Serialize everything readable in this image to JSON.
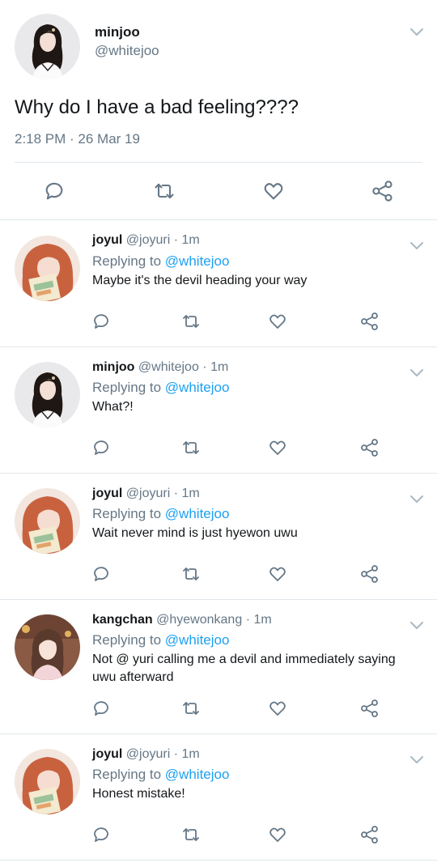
{
  "main_tweet": {
    "display_name": "minjoo",
    "handle": "@whitejoo",
    "text": "Why do I have a bad feeling????",
    "timestamp": "2:18 PM · 26 Mar 19",
    "avatar_icon": "avatar-minjoo",
    "actions": [
      "reply-icon",
      "retweet-icon",
      "like-icon",
      "share-icon"
    ]
  },
  "replies": [
    {
      "display_name": "joyul",
      "handle": "@joyuri",
      "time": "· 1m",
      "replying_prefix": "Replying to",
      "replying_to": "@whitejoo",
      "text": "Maybe it's the devil heading your way",
      "avatar_icon": "avatar-joyul"
    },
    {
      "display_name": "minjoo",
      "handle": "@whitejoo",
      "time": "· 1m",
      "replying_prefix": "Replying to",
      "replying_to": "@whitejoo",
      "text": "What?!",
      "avatar_icon": "avatar-minjoo"
    },
    {
      "display_name": "joyul",
      "handle": "@joyuri",
      "time": "· 1m",
      "replying_prefix": "Replying to",
      "replying_to": "@whitejoo",
      "text": "Wait never mind is just hyewon uwu",
      "avatar_icon": "avatar-joyul"
    },
    {
      "display_name": "kangchan",
      "handle": "@hyewonkang",
      "time": "· 1m",
      "replying_prefix": "Replying to",
      "replying_to": "@whitejoo",
      "text": "Not @ yuri calling me a devil and immediately saying uwu afterward",
      "avatar_icon": "avatar-kangchan"
    },
    {
      "display_name": "joyul",
      "handle": "@joyuri",
      "time": "· 1m",
      "replying_prefix": "Replying to",
      "replying_to": "@whitejoo",
      "text": "Honest mistake!",
      "avatar_icon": "avatar-joyul"
    }
  ],
  "colors": {
    "text": "#14171a",
    "secondary": "#657786",
    "mention": "#1da1f2",
    "divider": "#e1e8ed",
    "icon": "#657786"
  }
}
